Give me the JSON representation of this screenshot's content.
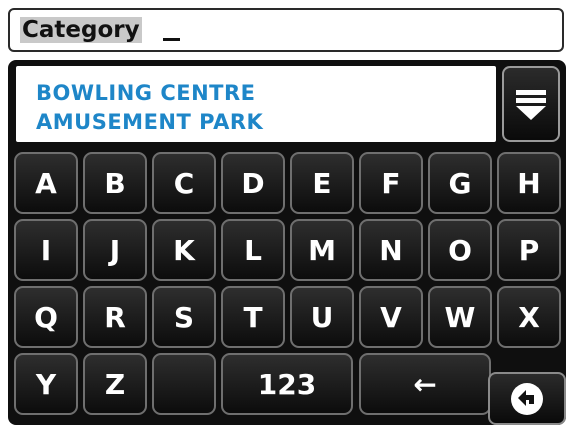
{
  "input": {
    "label": "Category"
  },
  "results": {
    "items": [
      "BOWLING CENTRE",
      "AMUSEMENT PARK"
    ]
  },
  "keyboard": {
    "row1": [
      "A",
      "B",
      "C",
      "D",
      "E",
      "F",
      "G",
      "H"
    ],
    "row2": [
      "I",
      "J",
      "K",
      "L",
      "M",
      "N",
      "O",
      "P"
    ],
    "row3": [
      "Q",
      "R",
      "S",
      "T",
      "U",
      "V",
      "W",
      "X"
    ],
    "row4": {
      "y": "Y",
      "z": "Z",
      "numeric": "123",
      "backspace": "←"
    }
  },
  "colors": {
    "result_text": "#1e86c8",
    "panel_bg": "#0f0f0f",
    "key_border": "#6f6f6f"
  },
  "icons": {
    "dropdown": "dropdown-arrow-icon",
    "back": "back-arrow-icon"
  }
}
